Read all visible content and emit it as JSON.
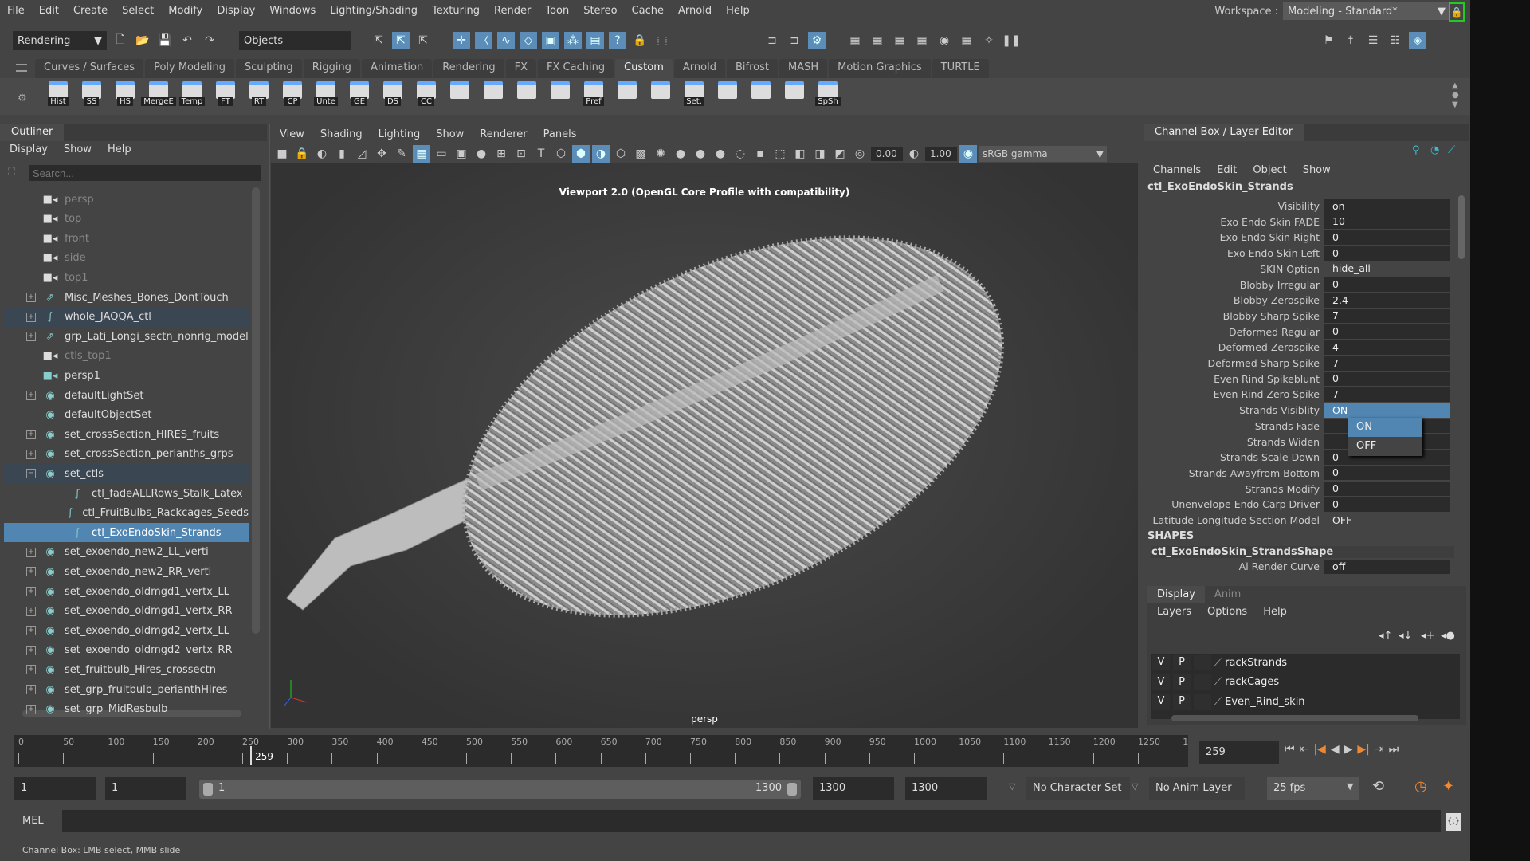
{
  "menubar": [
    "File",
    "Edit",
    "Create",
    "Select",
    "Modify",
    "Display",
    "Windows",
    "Lighting/Shading",
    "Texturing",
    "Render",
    "Toon",
    "Stereo",
    "Cache",
    "Arnold",
    "Help"
  ],
  "workspace": {
    "label": "Workspace :",
    "value": "Modeling - Standard*"
  },
  "statusline": {
    "menuset": "Rendering",
    "selection_mode": "Objects"
  },
  "shelf_tabs": [
    "Curves / Surfaces",
    "Poly Modeling",
    "Sculpting",
    "Rigging",
    "Animation",
    "Rendering",
    "FX",
    "FX Caching",
    "Custom",
    "Arnold",
    "Bifrost",
    "MASH",
    "Motion Graphics",
    "TURTLE"
  ],
  "shelf_active": "Custom",
  "shelf_buttons": [
    "Hist",
    "SS",
    "HS",
    "MergeE",
    "Temp",
    "FT",
    "RT",
    "CP",
    "Unte",
    "GE",
    "DS",
    "CC",
    "",
    "",
    "",
    "",
    "Pref",
    "",
    "",
    "Set.",
    "",
    "",
    "",
    "SpSh"
  ],
  "outliner": {
    "title": "Outliner",
    "menus": [
      "Display",
      "Show",
      "Help"
    ],
    "search_placeholder": "Search...",
    "items": [
      {
        "name": "persp",
        "type": "camera",
        "level": 1
      },
      {
        "name": "top",
        "type": "camera",
        "level": 1
      },
      {
        "name": "front",
        "type": "camera",
        "level": 1
      },
      {
        "name": "side",
        "type": "camera",
        "level": 1
      },
      {
        "name": "top1",
        "type": "camera",
        "level": 1
      },
      {
        "name": "Misc_Meshes_Bones_DontTouch",
        "type": "group",
        "expand": "+"
      },
      {
        "name": "whole_JAQQA_ctl",
        "type": "curve",
        "expand": "+",
        "state": "highlight"
      },
      {
        "name": "grp_Lati_Longi_sectn_nonrig_model",
        "type": "group",
        "expand": "+"
      },
      {
        "name": "ctls_top1",
        "type": "camera",
        "level": 1
      },
      {
        "name": "persp1",
        "type": "camera",
        "level": 1,
        "bright": true
      },
      {
        "name": "defaultLightSet",
        "type": "set",
        "expand": "+"
      },
      {
        "name": "defaultObjectSet",
        "type": "set"
      },
      {
        "name": "set_crossSection_HIRES_fruits",
        "type": "set",
        "expand": "+"
      },
      {
        "name": "set_crossSection_perianths_grps",
        "type": "set",
        "expand": "+"
      },
      {
        "name": "set_ctls",
        "type": "set",
        "expand": "−",
        "state": "highlight"
      },
      {
        "name": "ctl_fadeALLRows_Stalk_Latex",
        "type": "curve",
        "level": 2
      },
      {
        "name": "ctl_FruitBulbs_Rackcages_Seeds",
        "type": "curve",
        "level": 2
      },
      {
        "name": "ctl_ExoEndoSkin_Strands",
        "type": "curve",
        "level": 2,
        "state": "selected"
      },
      {
        "name": "set_exoendo_new2_LL_verti",
        "type": "set",
        "expand": "+"
      },
      {
        "name": "set_exoendo_new2_RR_verti",
        "type": "set",
        "expand": "+"
      },
      {
        "name": "set_exoendo_oldmgd1_vertx_LL",
        "type": "set",
        "expand": "+"
      },
      {
        "name": "set_exoendo_oldmgd1_vertx_RR",
        "type": "set",
        "expand": "+"
      },
      {
        "name": "set_exoendo_oldmgd2_vertx_LL",
        "type": "set",
        "expand": "+"
      },
      {
        "name": "set_exoendo_oldmgd2_vertx_RR",
        "type": "set",
        "expand": "+"
      },
      {
        "name": "set_fruitbulb_Hires_crossectn",
        "type": "set",
        "expand": "+"
      },
      {
        "name": "set_grp_fruitbulb_perianthHires",
        "type": "set",
        "expand": "+"
      },
      {
        "name": "set_grp_MidResbulb",
        "type": "set",
        "expand": "+"
      }
    ]
  },
  "viewport": {
    "menus": [
      "View",
      "Shading",
      "Lighting",
      "Show",
      "Renderer",
      "Panels"
    ],
    "exposure": "0.00",
    "gamma": "1.00",
    "color_space": "sRGB gamma",
    "hud_title": "Viewport 2.0 (OpenGL Core Profile with compatibility)",
    "camera": "persp"
  },
  "channelbox": {
    "title": "Channel Box / Layer Editor",
    "menus": [
      "Channels",
      "Edit",
      "Object",
      "Show"
    ],
    "node": "ctl_ExoEndoSkin_Strands",
    "channels": [
      {
        "label": "Visibility",
        "value": "on"
      },
      {
        "label": "Exo Endo Skin FADE",
        "value": "10"
      },
      {
        "label": "Exo Endo Skin Right",
        "value": "0"
      },
      {
        "label": "Exo Endo Skin Left",
        "value": "0"
      },
      {
        "label": "SKIN Option",
        "value": "hide_all",
        "plain": true
      },
      {
        "label": "Blobby Irregular",
        "value": "0"
      },
      {
        "label": "Blobby Zerospike",
        "value": "2.4"
      },
      {
        "label": "Blobby Sharp Spike",
        "value": "7"
      },
      {
        "label": "Deformed Regular",
        "value": "0"
      },
      {
        "label": "Deformed Zerospike",
        "value": "4"
      },
      {
        "label": "Deformed Sharp Spike",
        "value": "7"
      },
      {
        "label": "Even Rind Spikeblunt",
        "value": "0"
      },
      {
        "label": "Even Rind Zero Spike",
        "value": "7"
      },
      {
        "label": "Strands Visiblity",
        "value": "ON",
        "active": true
      },
      {
        "label": "Strands Fade",
        "value": ""
      },
      {
        "label": "Strands Widen",
        "value": ""
      },
      {
        "label": "Strands Scale Down",
        "value": "0"
      },
      {
        "label": "Strands Awayfrom Bottom",
        "value": "0"
      },
      {
        "label": "Strands Modify",
        "value": "0"
      },
      {
        "label": "Unenvelope Endo Carp Driver",
        "value": "0"
      },
      {
        "label": "Latitude Longitude Section Model",
        "value": "OFF",
        "plain": true
      }
    ],
    "dropdown_options": [
      "ON",
      "OFF"
    ],
    "dropdown_selected": "ON",
    "shapes_header": "SHAPES",
    "shape_node": "ctl_ExoEndoSkin_StrandsShape",
    "shape_channels": [
      {
        "label": "Ai Render Curve",
        "value": "off"
      }
    ]
  },
  "layer_editor": {
    "tabs": [
      "Display",
      "Anim"
    ],
    "menus": [
      "Layers",
      "Options",
      "Help"
    ],
    "layers": [
      {
        "v": "V",
        "p": "P",
        "name": "rackStrands"
      },
      {
        "v": "V",
        "p": "P",
        "name": "rackCages"
      },
      {
        "v": "V",
        "p": "P",
        "name": "Even_Rind_skin"
      }
    ]
  },
  "timeslider": {
    "ticks": [
      "0",
      "50",
      "100",
      "150",
      "200",
      "250",
      "300",
      "350",
      "400",
      "450",
      "500",
      "550",
      "600",
      "650",
      "700",
      "750",
      "800",
      "850",
      "900",
      "950",
      "1000",
      "1050",
      "1100",
      "1150",
      "1200",
      "1250",
      "1"
    ],
    "current_frame": "259",
    "current_frame_field": "259"
  },
  "range": {
    "start": "1",
    "playback_start": "1",
    "slider_start": "1",
    "slider_end": "1300",
    "playback_end": "1300",
    "end": "1300",
    "character_set": "No Character Set",
    "anim_layer": "No Anim Layer",
    "fps": "25 fps"
  },
  "command_line": {
    "lang": "MEL",
    "value": ""
  },
  "help_line": "Channel Box: LMB select, MMB slide"
}
